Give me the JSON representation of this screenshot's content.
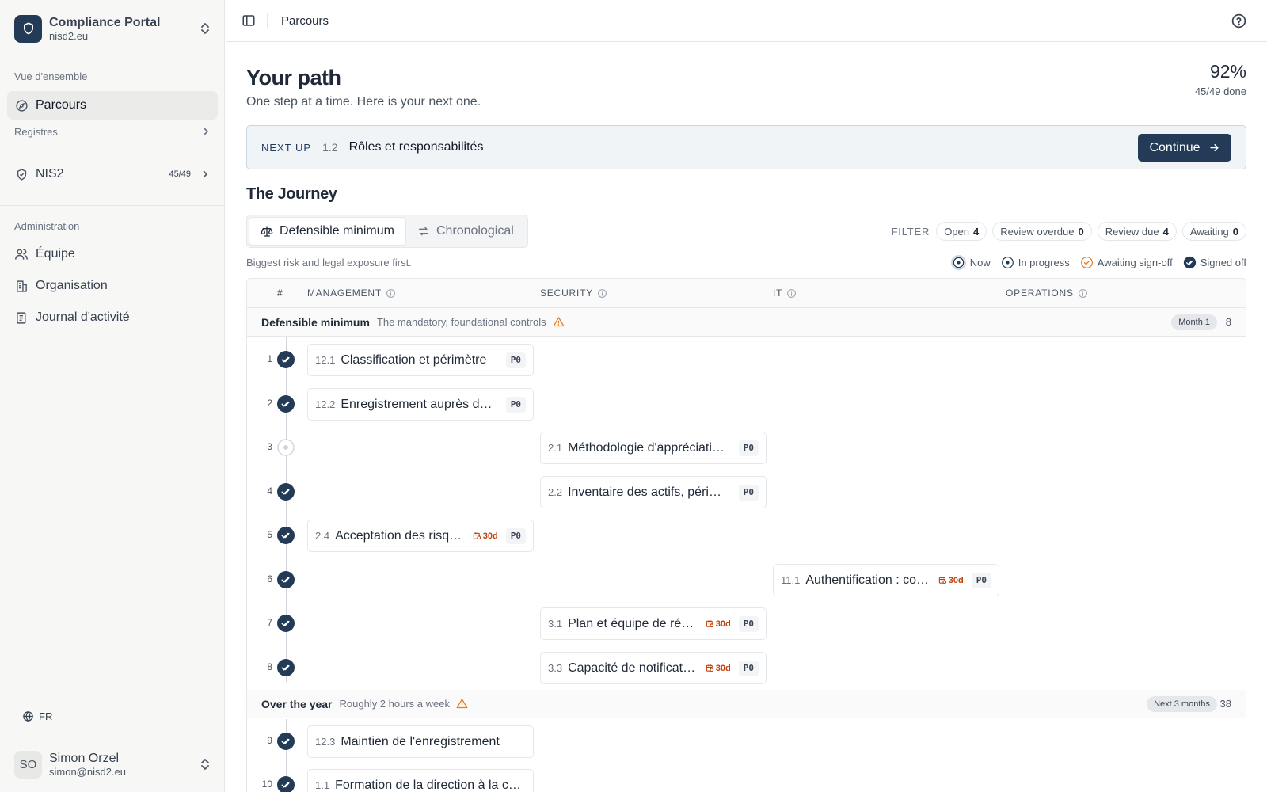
{
  "sidebar": {
    "brand_title": "Compliance Portal",
    "brand_sub": "nisd2.eu",
    "section_overview": "Vue d'ensemble",
    "item_parcours": "Parcours",
    "registres": "Registres",
    "item_nis2": "NIS2",
    "item_nis2_count": "45/49",
    "section_admin": "Administration",
    "item_equipe": "Équipe",
    "item_organisation": "Organisation",
    "item_journal": "Journal d'activité",
    "lang": "FR",
    "user_initials": "SO",
    "user_name": "Simon Orzel",
    "user_email": "simon@nisd2.eu"
  },
  "topbar": {
    "breadcrumb": "Parcours"
  },
  "main": {
    "title": "Your path",
    "subtitle": "One step at a time. Here is your next one.",
    "percent": "92%",
    "done": "45/49 done",
    "next_up_label": "NEXT UP",
    "next_up_num": "1.2",
    "next_up_title": "Rôles et responsabilités",
    "continue_label": "Continue",
    "journey_title": "The Journey",
    "seg_defensible": "Defensible minimum",
    "seg_chrono": "Chronological",
    "caption": "Biggest risk and legal exposure first.",
    "filter_label": "FILTER",
    "filters": [
      {
        "label": "Open",
        "count": "4"
      },
      {
        "label": "Review overdue",
        "count": "0"
      },
      {
        "label": "Review due",
        "count": "4"
      },
      {
        "label": "Awaiting",
        "count": "0"
      }
    ],
    "legend": {
      "now": "Now",
      "in_progress": "In progress",
      "awaiting": "Awaiting sign-off",
      "signed": "Signed off"
    }
  },
  "table": {
    "col_num": "#",
    "col_management": "MANAGEMENT",
    "col_security": "SECURITY",
    "col_it": "IT",
    "col_operations": "OPERATIONS",
    "group1": {
      "title": "Defensible minimum",
      "desc": "The mandatory, foundational controls",
      "badge": "Month 1",
      "count": "8"
    },
    "group2": {
      "title": "Over the year",
      "desc": "Roughly 2 hours a week",
      "badge": "Next 3 months",
      "count": "38"
    },
    "rows": [
      {
        "n": "1",
        "num": "12.1",
        "title": "Classification et périmètre",
        "due": "",
        "prio": "P0"
      },
      {
        "n": "2",
        "num": "12.2",
        "title": "Enregistrement auprès de l'autorité",
        "due": "",
        "prio": "P0"
      },
      {
        "n": "3",
        "num": "2.1",
        "title": "Méthodologie d'appréciation des risques",
        "due": "",
        "prio": "P0"
      },
      {
        "n": "4",
        "num": "2.2",
        "title": "Inventaire des actifs, périmètre",
        "due": "",
        "prio": "P0"
      },
      {
        "n": "5",
        "num": "2.4",
        "title": "Acceptation des risques",
        "due": "30d",
        "prio": "P0"
      },
      {
        "n": "6",
        "num": "11.1",
        "title": "Authentification : contrôle d'accès",
        "due": "30d",
        "prio": "P0"
      },
      {
        "n": "7",
        "num": "3.1",
        "title": "Plan et équipe de réponse",
        "due": "30d",
        "prio": "P0"
      },
      {
        "n": "8",
        "num": "3.3",
        "title": "Capacité de notification",
        "due": "30d",
        "prio": "P0"
      },
      {
        "n": "9",
        "num": "12.3",
        "title": "Maintien de l'enregistrement",
        "due": "",
        "prio": ""
      },
      {
        "n": "10",
        "num": "1.1",
        "title": "Formation de la direction à la cybersécurité",
        "due": "",
        "prio": ""
      }
    ]
  },
  "colors": {
    "accent": "#233b56",
    "due_orange": "#c2410c",
    "warn": "#ea7a1f"
  }
}
